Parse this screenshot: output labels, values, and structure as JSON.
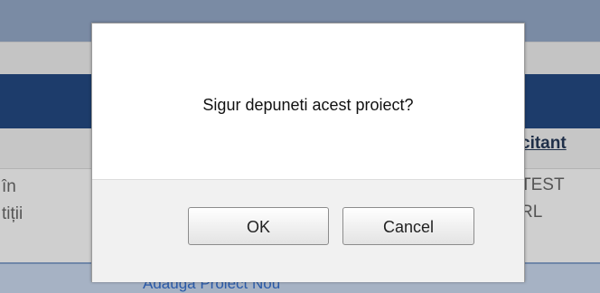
{
  "background": {
    "header_column": "citant",
    "left_lines": [
      "în",
      "tiții"
    ],
    "right_lines": [
      "TEST",
      "RL"
    ],
    "bottom_link": "Adauga Proiect Nou"
  },
  "dialog": {
    "message": "Sigur depuneti acest proiect?",
    "ok_label": "OK",
    "cancel_label": "Cancel"
  },
  "colors": {
    "navy_band": "#1d3c6b",
    "dialog_bg": "#ffffff",
    "footer_bg": "#f1f1f1"
  }
}
